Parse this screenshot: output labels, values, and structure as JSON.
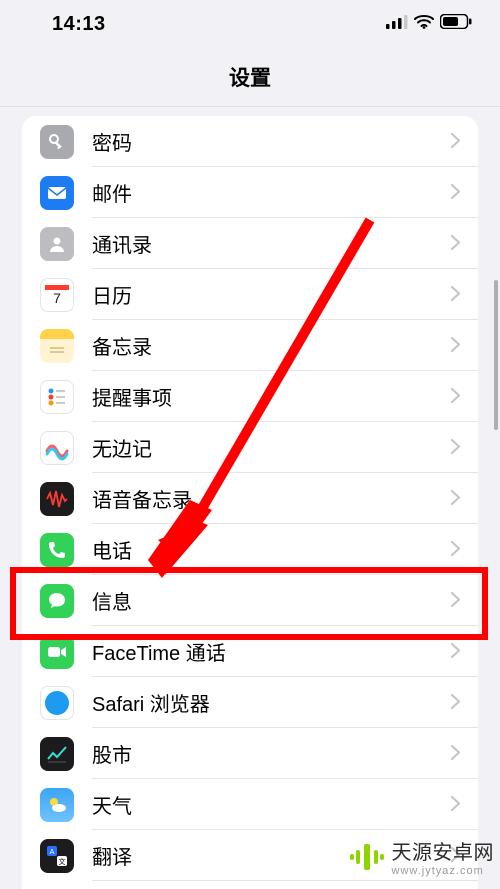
{
  "status_bar": {
    "time": "14:13"
  },
  "header": {
    "title": "设置"
  },
  "items": [
    {
      "id": "passwords",
      "label": "密码",
      "icon_class": "ic-passwords",
      "glyph": "key"
    },
    {
      "id": "mail",
      "label": "邮件",
      "icon_class": "ic-mail",
      "glyph": "mail"
    },
    {
      "id": "contacts",
      "label": "通讯录",
      "icon_class": "ic-contacts",
      "glyph": "contact"
    },
    {
      "id": "calendar",
      "label": "日历",
      "icon_class": "ic-calendar",
      "glyph": "calendar"
    },
    {
      "id": "notes",
      "label": "备忘录",
      "icon_class": "ic-notes",
      "glyph": "notes"
    },
    {
      "id": "reminders",
      "label": "提醒事项",
      "icon_class": "ic-reminders",
      "glyph": "reminders"
    },
    {
      "id": "freeform",
      "label": "无边记",
      "icon_class": "ic-freeform",
      "glyph": "freeform"
    },
    {
      "id": "voicememos",
      "label": "语音备忘录",
      "icon_class": "ic-voicememo",
      "glyph": "voicememo"
    },
    {
      "id": "phone",
      "label": "电话",
      "icon_class": "ic-phone",
      "glyph": "phone"
    },
    {
      "id": "messages",
      "label": "信息",
      "icon_class": "ic-messages",
      "glyph": "messages"
    },
    {
      "id": "facetime",
      "label": "FaceTime 通话",
      "icon_class": "ic-facetime",
      "glyph": "facetime"
    },
    {
      "id": "safari",
      "label": "Safari 浏览器",
      "icon_class": "ic-safari",
      "glyph": "safari"
    },
    {
      "id": "stocks",
      "label": "股市",
      "icon_class": "ic-stocks",
      "glyph": "stocks"
    },
    {
      "id": "weather",
      "label": "天气",
      "icon_class": "ic-weather",
      "glyph": "weather"
    },
    {
      "id": "translate",
      "label": "翻译",
      "icon_class": "ic-translate",
      "glyph": "translate"
    }
  ],
  "annotation": {
    "highlight_item_id": "messages"
  },
  "watermark": {
    "text": "天源安卓网",
    "domain": "www.jytyaz.com",
    "accent": "#8fd400"
  }
}
